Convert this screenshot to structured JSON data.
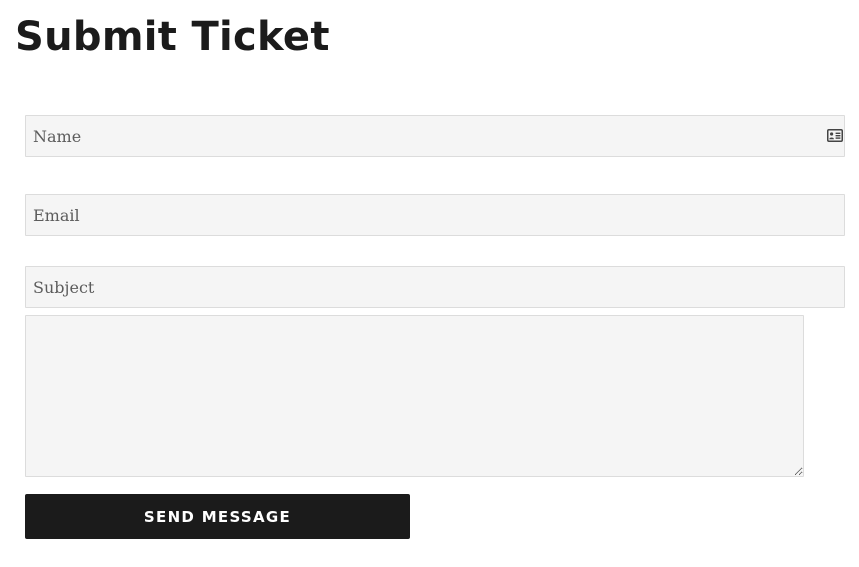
{
  "page": {
    "title": "Submit Ticket"
  },
  "form": {
    "name": {
      "placeholder": "Name",
      "value": "",
      "icon": "contact-card-icon"
    },
    "email": {
      "placeholder": "Email",
      "value": ""
    },
    "subject": {
      "placeholder": "Subject",
      "value": ""
    },
    "message": {
      "placeholder": "",
      "value": ""
    },
    "submit_label": "SEND MESSAGE"
  },
  "colors": {
    "text": "#1b1b1b",
    "field_background": "#f5f5f5",
    "field_border": "#dcdcdc",
    "button_background": "#1b1b1b",
    "button_text": "#ffffff"
  }
}
